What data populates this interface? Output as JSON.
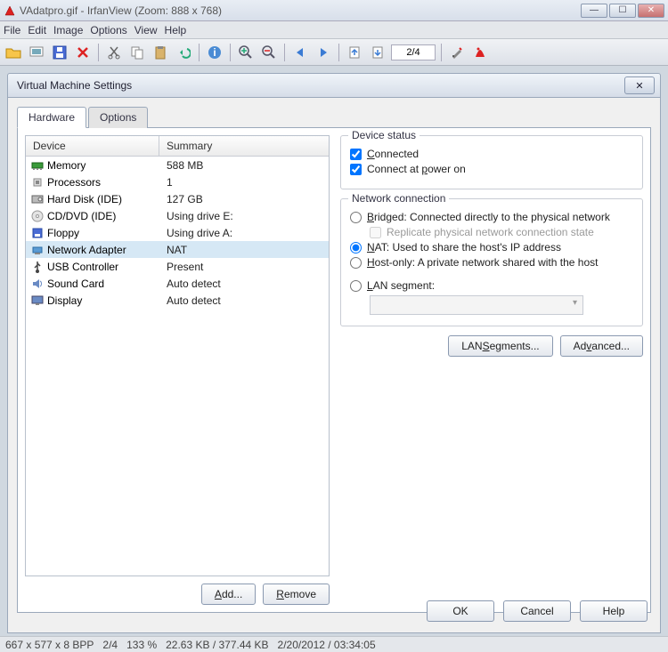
{
  "window": {
    "title": "VAdatpro.gif - IrfanView (Zoom: 888 x 768)"
  },
  "menus": [
    "File",
    "Edit",
    "Image",
    "Options",
    "View",
    "Help"
  ],
  "toolbar": {
    "page_indicator": "2/4"
  },
  "dialog": {
    "title": "Virtual Machine Settings",
    "tabs": {
      "hardware": "Hardware",
      "options": "Options"
    },
    "headers": {
      "device": "Device",
      "summary": "Summary"
    },
    "devices": [
      {
        "name": "Memory",
        "summary": "588 MB",
        "icon": "memory"
      },
      {
        "name": "Processors",
        "summary": "1",
        "icon": "cpu"
      },
      {
        "name": "Hard Disk (IDE)",
        "summary": "127 GB",
        "icon": "hdd"
      },
      {
        "name": "CD/DVD (IDE)",
        "summary": "Using drive E:",
        "icon": "cd"
      },
      {
        "name": "Floppy",
        "summary": "Using drive A:",
        "icon": "floppy"
      },
      {
        "name": "Network Adapter",
        "summary": "NAT",
        "icon": "net",
        "selected": true
      },
      {
        "name": "USB Controller",
        "summary": "Present",
        "icon": "usb"
      },
      {
        "name": "Sound Card",
        "summary": "Auto detect",
        "icon": "sound"
      },
      {
        "name": "Display",
        "summary": "Auto detect",
        "icon": "display"
      }
    ],
    "buttons": {
      "add": "Add...",
      "remove": "Remove",
      "lan_segments": "LAN Segments...",
      "advanced": "Advanced...",
      "ok": "OK",
      "cancel": "Cancel",
      "help": "Help"
    },
    "device_status": {
      "title": "Device status",
      "connected_u": "C",
      "connected_rest": "onnected",
      "powon_pre": "Connect at ",
      "powon_u": "p",
      "powon_post": "ower on"
    },
    "netconn": {
      "title": "Network connection",
      "bridged_u": "B",
      "bridged_rest": "ridged: Connected directly to the physical network",
      "replicate": "Replicate physical network connection state",
      "nat_u": "N",
      "nat_rest": "AT: Used to share the host's IP address",
      "hostonly_u": "H",
      "hostonly_rest": "ost-only: A private network shared with the host",
      "lan_u": "L",
      "lan_rest": "AN segment:"
    }
  },
  "statusbar": {
    "dims": "667 x 577 x 8 BPP",
    "page": "2/4",
    "zoom": "133 %",
    "size": "22.63 KB / 377.44 KB",
    "datetime": "2/20/2012 / 03:34:05"
  }
}
